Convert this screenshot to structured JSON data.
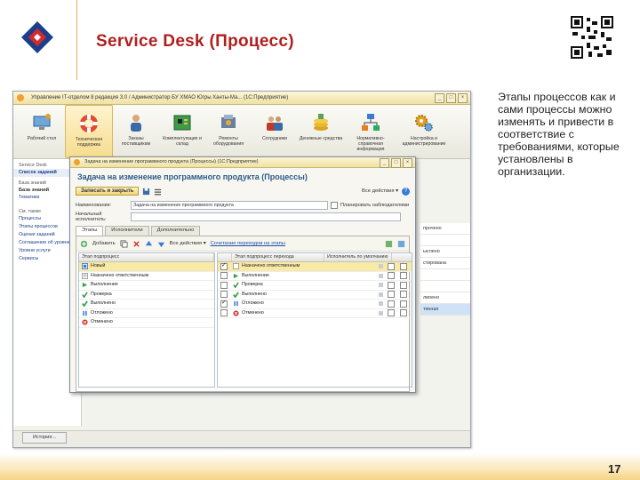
{
  "slide": {
    "title": "Service Desk (Процесс)",
    "side_text": "Этапы процессов как и сами процессы можно изменять  и привести в соответствие с требованиями, которые установлены в организации.",
    "page_number": "17",
    "colors": {
      "title": "#b21e1e",
      "accent_band": "#f6d487"
    }
  },
  "app": {
    "window_title": "Управление IT-отделом 8 редакция 3.0 / Администратор БУ ХМАО Югры Ханты-Ма... (1С:Предприятие)",
    "ribbon": [
      {
        "label": "Рабочий стол",
        "icon": "desktop-icon"
      },
      {
        "label": "Техническая поддержка",
        "icon": "lifebuoy-icon"
      },
      {
        "label": "Заказы поставщикам",
        "icon": "person-icon"
      },
      {
        "label": "Комплектующие и склад",
        "icon": "board-icon"
      },
      {
        "label": "Ремонты оборудования",
        "icon": "repair-icon"
      },
      {
        "label": "Сотрудники",
        "icon": "people-icon"
      },
      {
        "label": "Денежные средства",
        "icon": "coins-icon"
      },
      {
        "label": "Нормативно-справочная информация",
        "icon": "hierarchy-icon"
      },
      {
        "label": "Настройка и администрирование",
        "icon": "gears-icon"
      }
    ],
    "left_panel": {
      "section_title": "Service Desk",
      "subsection": "Список заданий",
      "groups": [
        "База знаний"
      ],
      "bold_item": "База знаний",
      "items_top": [
        "Тематики"
      ],
      "see_also": "См. также",
      "items": [
        "Процессы",
        "Этапы процессов",
        "Оценки заданий",
        "Соглашение об уровне",
        "Уровни услуги",
        "Сервисы"
      ]
    },
    "right_list": [
      "прочено",
      "",
      "ыслено",
      "стирована",
      "",
      "",
      "лиоено",
      "тянная"
    ],
    "history_button": "История..."
  },
  "dialog": {
    "window_title": "Задача на изменение программного продукта (Процессы) (1С:Предприятие)",
    "heading": "Задача на изменение программного продукта (Процессы)",
    "save_close": "Записать и закрыть",
    "more_actions": "Все действия ▾",
    "help": "?",
    "name_label": "Наименование:",
    "name_value": "Задача на изменение программного продукта",
    "plan_label": "Планировать наблюдателями",
    "initial_label": "Начальный исполнитель:",
    "tabs": [
      "Этапы",
      "Исполнители",
      "Дополнительно"
    ],
    "toolbar": {
      "add": "Добавить",
      "more": "Все действия ▾",
      "link": "Сочетание переходов на этапы"
    },
    "left_grid": {
      "header": "Этап подпроцесс",
      "rows": [
        {
          "label": "Новый",
          "icon": "new-icon",
          "selected": true
        },
        {
          "label": "Назначено ответственным",
          "icon": "assign-icon"
        },
        {
          "label": "Выполнение",
          "icon": "execute-icon"
        },
        {
          "label": "Проверка",
          "icon": "check-icon"
        },
        {
          "label": "Выполнено",
          "icon": "done-icon"
        },
        {
          "label": "Отложено",
          "icon": "pause-icon"
        },
        {
          "label": "Отменено",
          "icon": "cancel-icon"
        }
      ]
    },
    "right_grid": {
      "headers": [
        "Этап подпроцесс перехода",
        "Исполнитель по умолчанию"
      ],
      "rows": [
        {
          "label": "Назначено ответственным",
          "checked": true,
          "selected": true
        },
        {
          "label": "Выполнение",
          "checked": false
        },
        {
          "label": "Проверка",
          "checked": false
        },
        {
          "label": "Выполнено",
          "checked": false
        },
        {
          "label": "Отложено",
          "checked": true
        },
        {
          "label": "Отменено",
          "checked": false
        }
      ]
    }
  }
}
